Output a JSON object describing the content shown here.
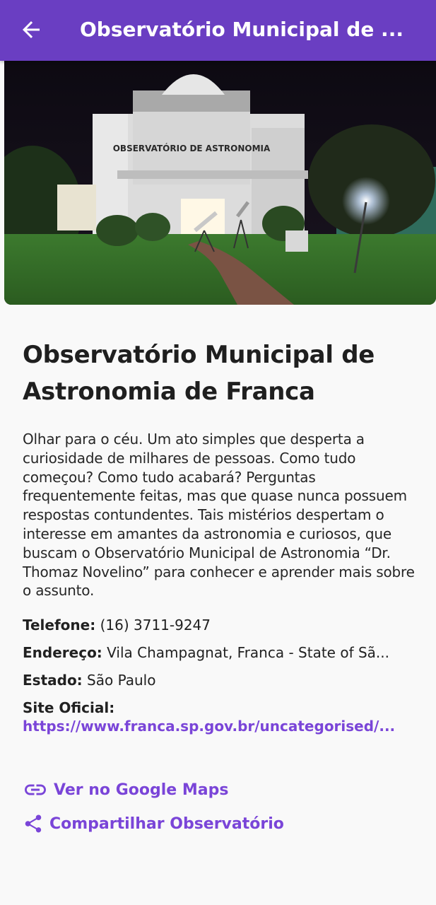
{
  "appbar": {
    "title": "Observatório Municipal de ...",
    "back_icon": "arrow-left-icon",
    "color": "#6a3ec2"
  },
  "hero": {
    "alt": "Observatório de Astronomia building at night",
    "sign_text": "OBSERVATÓRIO DE ASTRONOMIA"
  },
  "detail": {
    "title": "Observatório Municipal de Astronomia de Franca",
    "description": "Olhar para o céu. Um ato simples que desperta a curiosidade de milhares de pessoas. Como tudo começou? Como tudo acabará? Perguntas frequentemente feitas, mas que quase nunca possuem respostas contundentes. Tais mistérios despertam o interesse em amantes da astronomia e curiosos, que buscam o Observatório Municipal de Astronomia “Dr. Thomaz Novelino” para conhecer e aprender mais sobre o assunto.",
    "phone_label": "Telefone:",
    "phone": "(16) 3711-9247",
    "address_label": "Endereço:",
    "address": "Vila Champagnat, Franca - State of Sã...",
    "state_label": "Estado:",
    "state": "São Paulo",
    "site_label": "Site Oficial:",
    "site": "https://www.franca.sp.gov.br/uncategorised/..."
  },
  "actions": {
    "maps_label": "Ver no Google Maps",
    "maps_icon": "link-icon",
    "share_label": "Compartilhar Observatório",
    "share_icon": "share-icon",
    "accent": "#7a45d8"
  }
}
